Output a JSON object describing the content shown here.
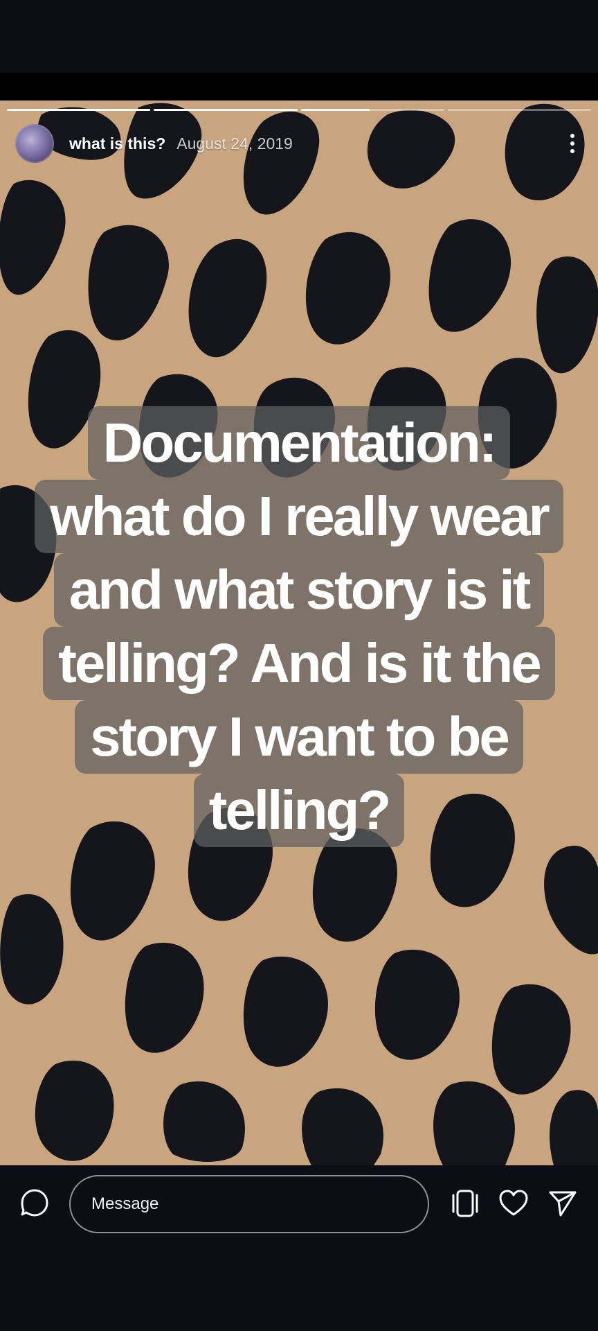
{
  "story": {
    "username": "what is this?",
    "date": "August 24, 2019",
    "progress": [
      1,
      1,
      0.48,
      0
    ],
    "caption_lines": [
      "Documentation:",
      "what do I really wear",
      "and what story is it",
      "telling? And is it the",
      "story I want to be",
      "telling?"
    ]
  },
  "reply": {
    "placeholder": "Message"
  },
  "icons": {
    "more": "more-vertical-icon",
    "camera": "camera-icon",
    "stories": "stories-icon",
    "like": "heart-icon",
    "share": "send-icon"
  },
  "colors": {
    "background": "#0b0e14",
    "fabric": "#c9a57f",
    "spots": "#14161c"
  }
}
